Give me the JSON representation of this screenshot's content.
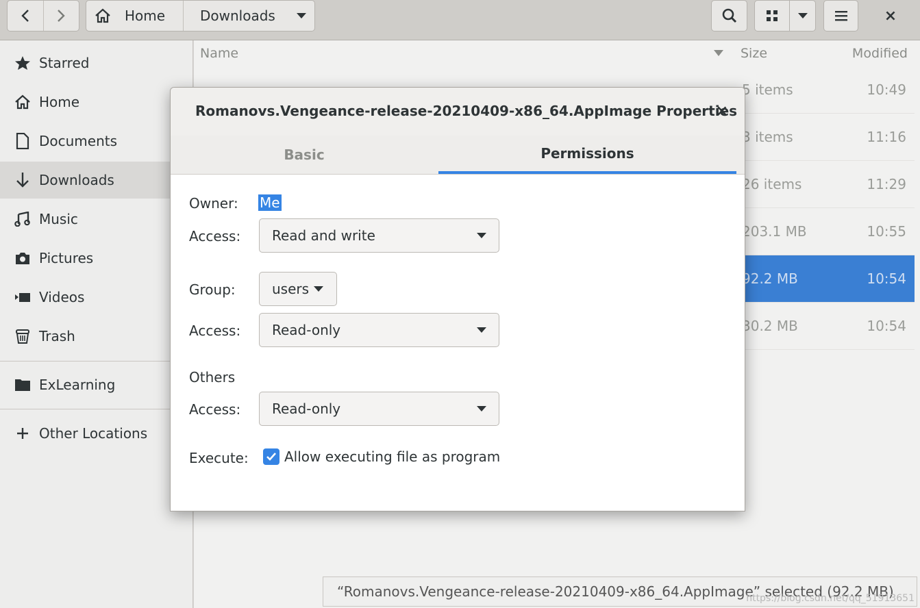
{
  "header": {
    "back_icon": "chevron-left-icon",
    "forward_icon": "chevron-right-icon",
    "breadcrumb": [
      "Home",
      "Downloads"
    ],
    "search_icon": "search-icon",
    "view_icon": "grid-icon",
    "menu_icon": "hamburger-icon",
    "close_label": "×"
  },
  "sidebar": {
    "items": [
      {
        "label": "Starred",
        "icon": "star-icon"
      },
      {
        "label": "Home",
        "icon": "home-icon"
      },
      {
        "label": "Documents",
        "icon": "document-icon"
      },
      {
        "label": "Downloads",
        "icon": "download-icon",
        "active": true
      },
      {
        "label": "Music",
        "icon": "music-icon"
      },
      {
        "label": "Pictures",
        "icon": "camera-icon"
      },
      {
        "label": "Videos",
        "icon": "video-icon"
      },
      {
        "label": "Trash",
        "icon": "trash-icon"
      },
      {
        "label": "ExLearning",
        "icon": "folder-icon"
      },
      {
        "label": "Other Locations",
        "icon": "plus-icon"
      }
    ]
  },
  "filelist": {
    "columns": {
      "name": "Name",
      "size": "Size",
      "modified": "Modified"
    },
    "rows": [
      {
        "size": "5 items",
        "modified": "10:49"
      },
      {
        "size": "3 items",
        "modified": "11:16"
      },
      {
        "size": "26 items",
        "modified": "11:29"
      },
      {
        "size": "203.1 MB",
        "modified": "10:55"
      },
      {
        "size": "92.2 MB",
        "modified": "10:54",
        "selected": true
      },
      {
        "size": "30.2 MB",
        "modified": "10:54"
      }
    ]
  },
  "status": {
    "text": "“Romanovs.Vengeance-release-20210409-x86_64.AppImage” selected (92.2 MB)",
    "watermark": "https://blog.csdn.net/qq_51913651"
  },
  "dialog": {
    "title": "Romanovs.Vengeance-release-20210409-x86_64.AppImage Properties",
    "close": "×",
    "tabs": {
      "basic": "Basic",
      "permissions": "Permissions"
    },
    "owner_label": "Owner:",
    "owner_value": "Me",
    "access_label": "Access:",
    "owner_access": "Read and write",
    "group_label": "Group:",
    "group_value": "users",
    "group_access": "Read-only",
    "others_label": "Others",
    "others_access": "Read-only",
    "execute_label": "Execute:",
    "execute_checkbox": "Allow executing file as program",
    "accent": "#3584e4"
  }
}
